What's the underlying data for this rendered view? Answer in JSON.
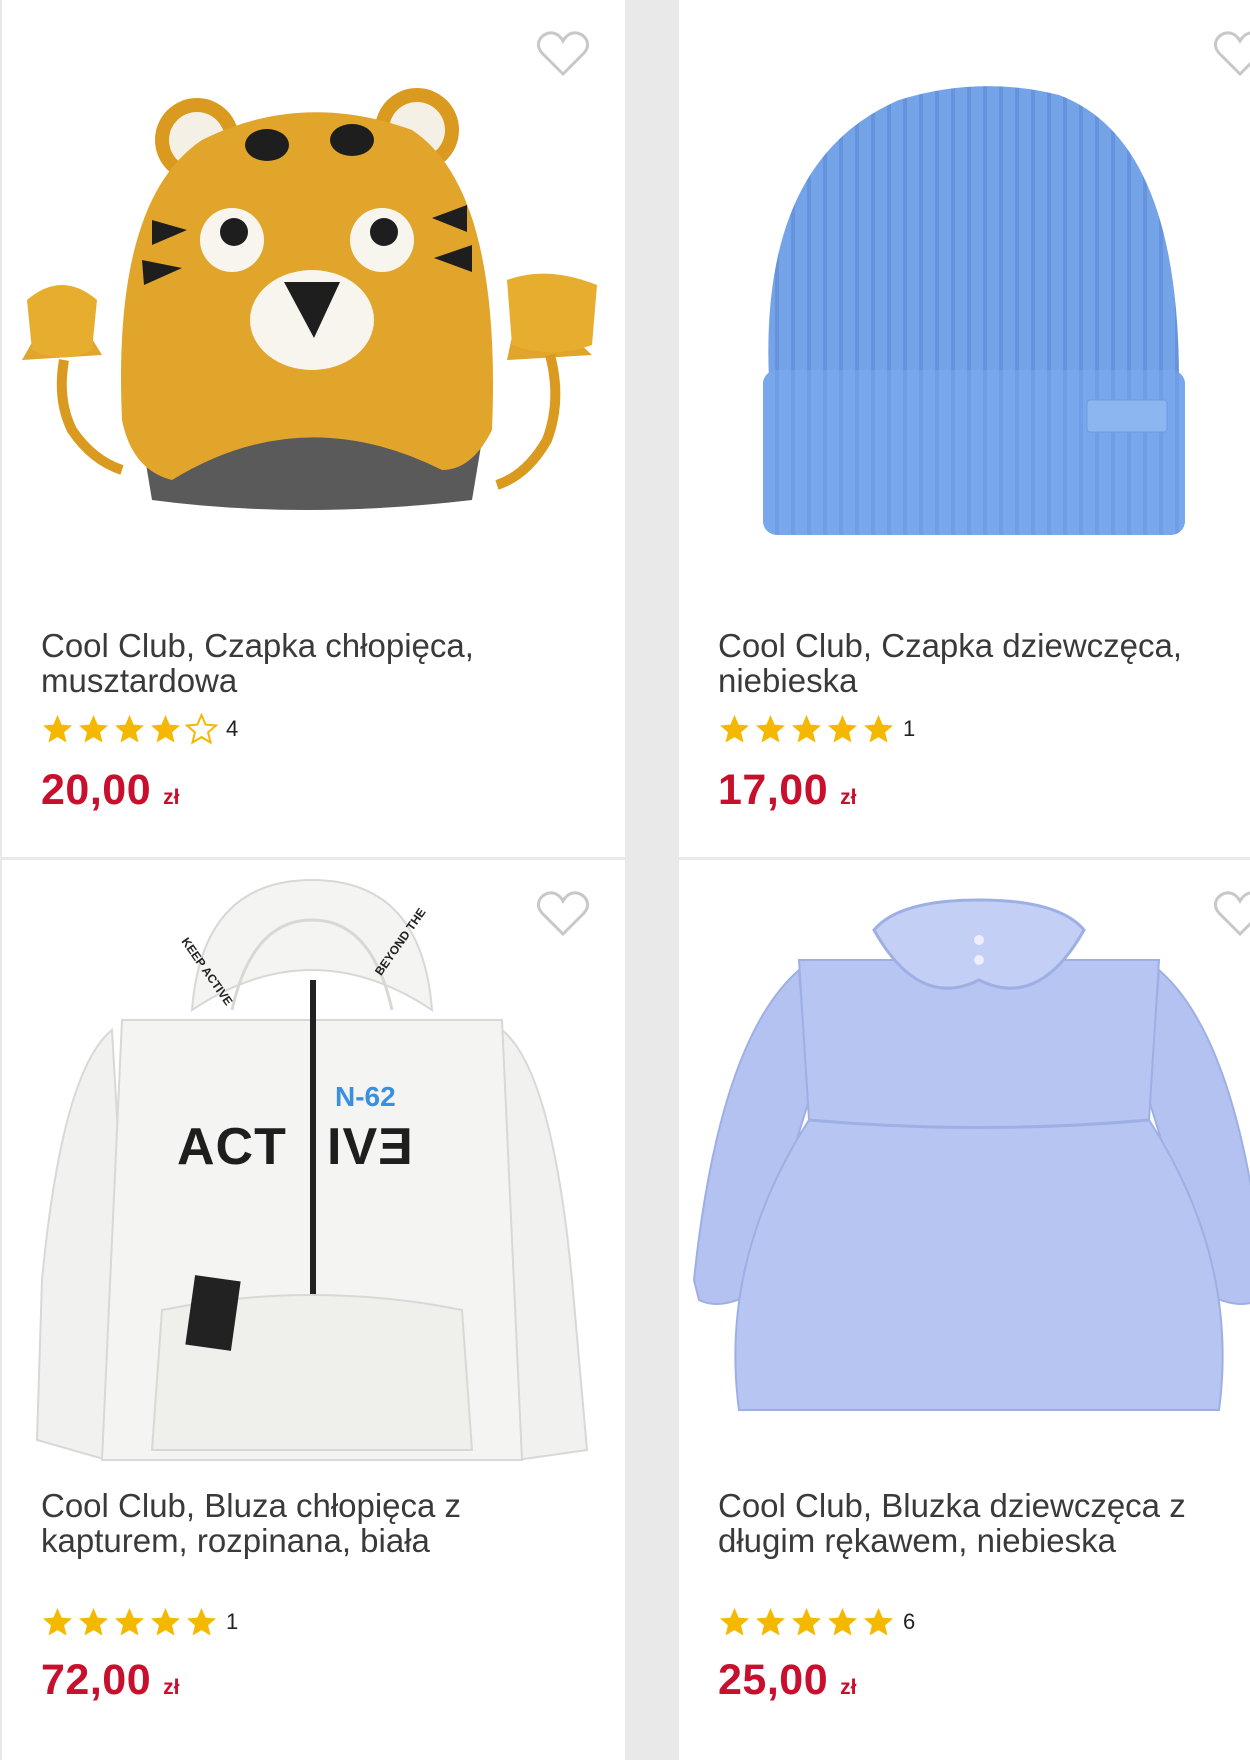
{
  "products": [
    {
      "title": "Cool Club, Czapka chłopięca, musztardowa",
      "rating": 4,
      "rating_count": "4",
      "price": "20,00",
      "currency": "zł",
      "image": "mustard-tiger-knit-hat"
    },
    {
      "title": "Cool Club, Czapka dziewczęca, niebieska",
      "rating": 5,
      "rating_count": "1",
      "price": "17,00",
      "currency": "zł",
      "image": "blue-ribbed-beanie"
    },
    {
      "title": "Cool Club, Bluza chłopięca z kapturem, rozpinana, biała",
      "rating": 5,
      "rating_count": "1",
      "price": "72,00",
      "currency": "zł",
      "image": "white-zip-hoodie",
      "print_text": {
        "main_left": "ACT",
        "main_right": "IVƎ",
        "badge": "N-62",
        "hood_left": "KEEP ACTIVE",
        "hood_right": "BEYOND THE"
      }
    },
    {
      "title": "Cool Club, Bluzka dziewczęca z długim rękawem, niebieska",
      "rating": 5,
      "rating_count": "6",
      "price": "25,00",
      "currency": "zł",
      "image": "light-blue-collar-blouse"
    }
  ],
  "colors": {
    "price": "#c8102e",
    "star": "#f5b800",
    "heart_outline": "#c8c8c8"
  },
  "icons": {
    "favorite": "heart-outline-icon",
    "star_full": "star-filled-icon",
    "star_empty": "star-outline-icon"
  }
}
